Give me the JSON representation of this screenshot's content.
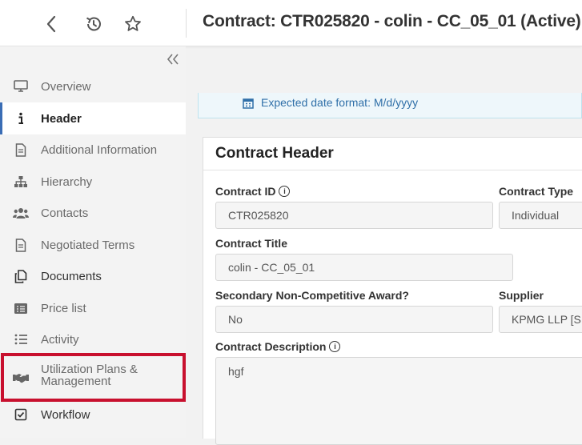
{
  "header": {
    "title": "Contract: CTR025820 - colin - CC_05_01 (Active)"
  },
  "sidebar": {
    "items": [
      {
        "label": "Overview",
        "icon": "monitor-icon"
      },
      {
        "label": "Header",
        "icon": "info-icon"
      },
      {
        "label": "Additional Information",
        "icon": "document-icon"
      },
      {
        "label": "Hierarchy",
        "icon": "hierarchy-icon"
      },
      {
        "label": "Contacts",
        "icon": "contacts-icon"
      },
      {
        "label": "Negotiated Terms",
        "icon": "document-icon"
      },
      {
        "label": "Documents",
        "icon": "documents-icon"
      },
      {
        "label": "Price list",
        "icon": "price-list-icon"
      },
      {
        "label": "Activity",
        "icon": "list-icon"
      },
      {
        "label": "Utilization Plans &\nManagement",
        "icon": "handshake-icon"
      },
      {
        "label": "Workflow",
        "icon": "checkbox-icon"
      }
    ],
    "active_item": "Header",
    "highlighted_item": "Utilization Plans & Management",
    "highlight_color": "#c8102e"
  },
  "banner": {
    "text": "Expected date format: M/d/yyyy"
  },
  "contract_header": {
    "title": "Contract Header",
    "fields": {
      "contract_id": {
        "label": "Contract ID",
        "value": "CTR025820"
      },
      "contract_type": {
        "label": "Contract Type",
        "value": "Individual"
      },
      "contract_title": {
        "label": "Contract Title",
        "value": "colin - CC_05_01"
      },
      "secondary_award": {
        "label": "Secondary Non-Competitive Award?",
        "value": "No"
      },
      "supplier": {
        "label": "Supplier",
        "value": "KPMG LLP [S"
      },
      "description": {
        "label": "Contract Description",
        "value": "hgf"
      }
    }
  },
  "colors": {
    "accent": "#3a6db5",
    "banner_text": "#2f6fa8"
  }
}
